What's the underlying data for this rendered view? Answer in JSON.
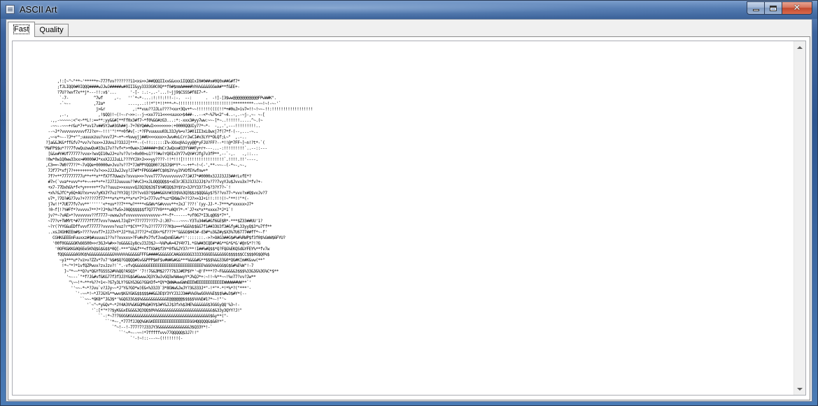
{
  "window": {
    "title": "ASCII Art",
    "caption_buttons": [
      "minimize",
      "maximize",
      "close"
    ]
  },
  "tabs": [
    {
      "label": "Fast",
      "active": true
    },
    {
      "label": "Quality",
      "active": false
    }
  ],
  "ascii_art": {
    "rows": [
      "",
      "",
      "",
      "      ,!:[~\"~\"**~'*****+~777fvv???????11<xs>>J##QQQIIxx&&xxx1IQQQIxI0#0##x#0Q0x##&#f7*",
      "      ;fJLIQQ0#0IQQQ####wJJwJ#####w#0III&yy3333G0C0Q**f0#$mmA####hh%%&&&GGGeA#**f&EE+-",
      "      ?7U??wvf7x**j*---!!:v$'...      '-[- :.:-,.-'...!~jj9$CSSS#f8I7~*-",
      "       `-7-           ^7wf     ,-.   ''`*~*-...:!:!!:!!!-:-.  --:      .  -!]-[3$ww@@@@@@@@@@@FPwW#K\".",
      "       -`~--          ,72a*          ....,..:!!*\"!*!!***~*~!!!!!!!!!!!!!!!!!!!!!!!!*********--~~!~!-~-'`",
      "                       j>&r            ,:**vuu??JJLu????<xx+3Qv+*~~!!!!!!((((!!*+#0uJ>iv7=!!~!~~-!!:!!!!!!!!!!!!!!!!!!",
      "       ,.-,             ,!$QQ)!~(!~-r~>>:--j~<xx7711<<<<uuxx>$4##-..--<*~%7%<2\"~4..-,.-~j-,~- ~-[",
      "   .,,-~~~~~:<\"<~**L!:==**:yy&&#[**Ff0x3#f7~*f0%&G#zG3...:*:-xxx3#yy7ww:~~-[*~..!!!!!!.....^~.(~",
      "   -~~--~~~+r&u*7+*vv17v##5YJw#3Gh##j-7+76YQ##wI>>>>>>>>:+0000QQUIy7?*~*-  -,,.',---!!!!!!!!!..",
      "  --~J*?vvvvvvvvvvf7J?x+~-!!!'\"!**+0f#v[-:*?FPvuuuuu03L33Jy%=v?J#01II3xLOwxj7f(7*f-(--,...-~..",
      "  ,~~v*~--?J*+\"\";uuuuxzuu?vvv7J*~+*~+%vwyjj##U<<<xxx>>Jwv#xLCrrJwCI#x3LYY*OLQf;L~\"  ,.-..",
      " ?]a&&JK&*ff&fv7*vv?v?xx>>JJUvuJ?33JJ]***--(~!!::::::I%~XXxq%%iyy@@*yFJU?FF?--*!!@*7FF~]~n!?t*-`(",
      "'MaFP$$u*???7fvwQuzwwQv#33u17v??vf<*>+0we>JJ#####+dmCrJwQxx#33YY##Fy+r+---...-:!!!!!!!!!`..--::---",
      "  [&&x#Y#Uf77777?vvx>?wvQI10wJJ+u?v?7v!>0x00>u1???#w?rQ0Ix3Y77vQY#YJfg7v3fP**,--`-,.   .,::...",
      " !0w*0w1Q0ww33xx>#0000#J*xxXJJJJuLL???YYJX+J>>>yy????-!!*!!![!!!!!!!!!!!!!!!!!!`.!!!!.!!'----.",
      " ,C3==~7W0?77??*~7vQQe+00000w>Jvu?v??7*7JmPPYQQQ00?J$3J$H*Y*-~-++*~!~(-',**-~~--(-*~-,~-,",
      "  7Jf77*xfj7?+++++++++7v?<>>JJJJwJJvy?J7#f*FPGGG##fC$0$3Yvy3YVOfEYwfnw+*",
      "  7f?+**777777777u**+**x**fX7f7Uwwzv?xvvu>>>?vvv7777vvvvvvvvv7?J#J7*#0000x3JJJ3JJ3##rLvfE*?",
      "  #7>(`vva*+vvv*+*+~~++*+*+?JJ7JJuuuuu??#vC3+xJLOQQQQ$$+xE3rJE3J3J3JJJ$?v?7?7vyYJu$Jvvu3x?*fv?+-",
      "  +x7-77Dxh&%*f<*y+++++**7v??uuuz>>xxuvvQJ3Q3Q$3$T$Y#EQQ$3Y$Yz>3JYY33?7>$?3?Y7?~`!",
      "  +x%?&JfC*y6Q+AU?xv+vv?yKVJY7vz?YYJQj?JY?vvU3?$$##&&%Y#33$%%3Q3$$z$QQ&&y$?5??vv77~*vvv?x#Q$vvJv?7",
      "  v7*,?7O?#G?7vv?+?????7f77***x*x**x**x*x*7*1<777vvf*uz*EKWw7+??J?>>3J+i!!:!!!(!~\"**!!\"*(-",
      "  j7w!!*7UE77fv7vv**''''''<*+uv*??7***w?****<&&Wv*&#vvvv**+JxJ`???!`(yy-JJ-*-7***w*xxxxx>J7*",
      "  !0~f[!?Y#Ff*?vvvvv7**?*?J*0u?fw5>J0QQ$$$$$f7Q777Y0***u0QY?*-*`J7+x*x**xxxx7*J*1`!",
      "  jv?*~?vAE>*?vvvvvvv??f7777~vwxwJvfvvvvvvvvvvvvvvv~**~f*------*vf0G7*I3Lq@G$*7*\",",
      "  ~77?v+TWMYt*#77777ff7f7vvv?vwwvL7JqIY*77?777??77~J:J07~---~~~-Y3Tu34#&#&f6&E$R*-***$Z33##UU'1?",
      "  ~?r(?YYG&uEDffvvvf77777?vvvvv?vuz?r*$CY**7?vJ??777?7?K$u==+%&&%$$&G7f1##33U3f3#&fy#L33yyQ$3*u7ff**",
      "  ..xsJXGHKEEm#$>????vvvf7+JJJ7>Y*JJ*YuLJ?7?J*<COX<*&f???*\"&&&G$H43#-d3#*u3&Z#y$X3%7U6777##ff*~-f'",
      "    CGHK&EEEmFuuxxz#$#uuuuu1??v??xvxxv>?Fv#xPx7fvfJvwQxmE&#w*!':::::::.->?>OAG3##G$#%#%RWP$f3f0$%GmW$6FYU?",
      "    '00f0G&&&GK%66S00>>r3GJ>%#>>?o&&&&1y8cvJ3J3$J~~%%PwA=4JY4Y71.*&%##3CQE#*#&**&*&*&'#@r&*?!?G",
      "     '0OFK&KK&0Q6Ee5KhQ$&$&$$*0Q[-***^&%&f**<ffXX#$f3Y*0fk&JY37r**!I##%#Q$$*Q?FQ&%EKQSd&YFEY%**fv7w",
      "      fQQ&&&&&6G0G$%&&&&&&&&&&&%%%%%%&&&&&FFF&####&&&&&GCAA&GGGGG33333GGGE&&&&GGG$$$$$$CC$$$0G$Q0%$",
      "       ~y1***u*?vz>v?ZZv*7v7'%$#$Q?GQQQQ#Gv&&PPP$mF$v#W#&#&&***%&&&#&**$$$%&&33&0*QG#K[m#K&vw(**\"",
      "        !*~\"*?*1vfQZPwvx?zvJzv?!`\".-vfvQ&&&GGGEEEEEEEEEEEEEEEEEEEEEEEE%GGG%%GGG$G$G#%E%W\"!-7",
      "         ]~\"*~~**Q?u*Q&YfGSSS2#%%QQ?ASQ3*`'7!!7&&3M$2?7?7$3J#EP$Y*'~@'F***?7~F&&&&&&3$$$%33&3&%3G%C*$**",
      "          '~---`\"*f?J&#vf&K&77f3f3J3Y&$&#&wwwJQ3Y3wJvGQ3w%WwwyY*J%QJ*+:~!!~%**~~!%v77?vv?Jw**",
      "           \"\\~~!*~**+%??+1<~?G7y3LY?G&Y&3&G?G&H3f=*QY*QWW#ww&WmEEEWEEEEEEEEEEEEWWWW##WW**`'",
      "            ''~~-*~*?Jvu`v?JJy~~*J\"Y&?GO*w)E&<%33J3`3*8GWw&JwJY?3&333J*\"-!*\"*-*!*%*?(\"***'-",
      "              `'-~~*!~*J7J&Y&**wwv$K&Y&K&$$$$$##&&3E$Y3YYJ3JJ3##%%G%wGG%%%E$$$%#w3$#Y*(--",
      "                ``~~-*GK8*^J&3$*'%&QG33&$$%&&&&&&&&&&&E@@@@@@$$$$$%%%E#1?*~-!\"'~",
      "                   '`~\"~*y&Qv*~*JY4A3V%&K&QM%Q#3Y$3#Y&JJ$3fx%$3HE%&&&&&G$3GGGyQQ'%3~!-",
      "                     '`:[*\"*??$yK&&xE&&&&3Q3QQ$0%%&&&&&&&&&&&&&&&&&&&&&&&&$&33y3QYY?J!\"",
      "                        ``-:*~7?7GGG&K&&&&&&&&&&&&&&&&&&&&&&&&&&&&&&&&&&G$&y**(\"-",
      "                           ``'*~-,*777fJJQQ%&K&KEEEEEEEEEEEEEEEEGGHQQQQQ&$&6Y*\"-",
      "                              `^~!--!-777?7?J33JY3&&&&&&&&&&&&&&3$Q33Y*!-`",
      "                                 ``'~*~--~~!*7fffffvvv77QQQQQ$3J7!!\"",
      "                                      `'-!~!::---~-(!!!!!!!(-",
      ""
    ]
  }
}
